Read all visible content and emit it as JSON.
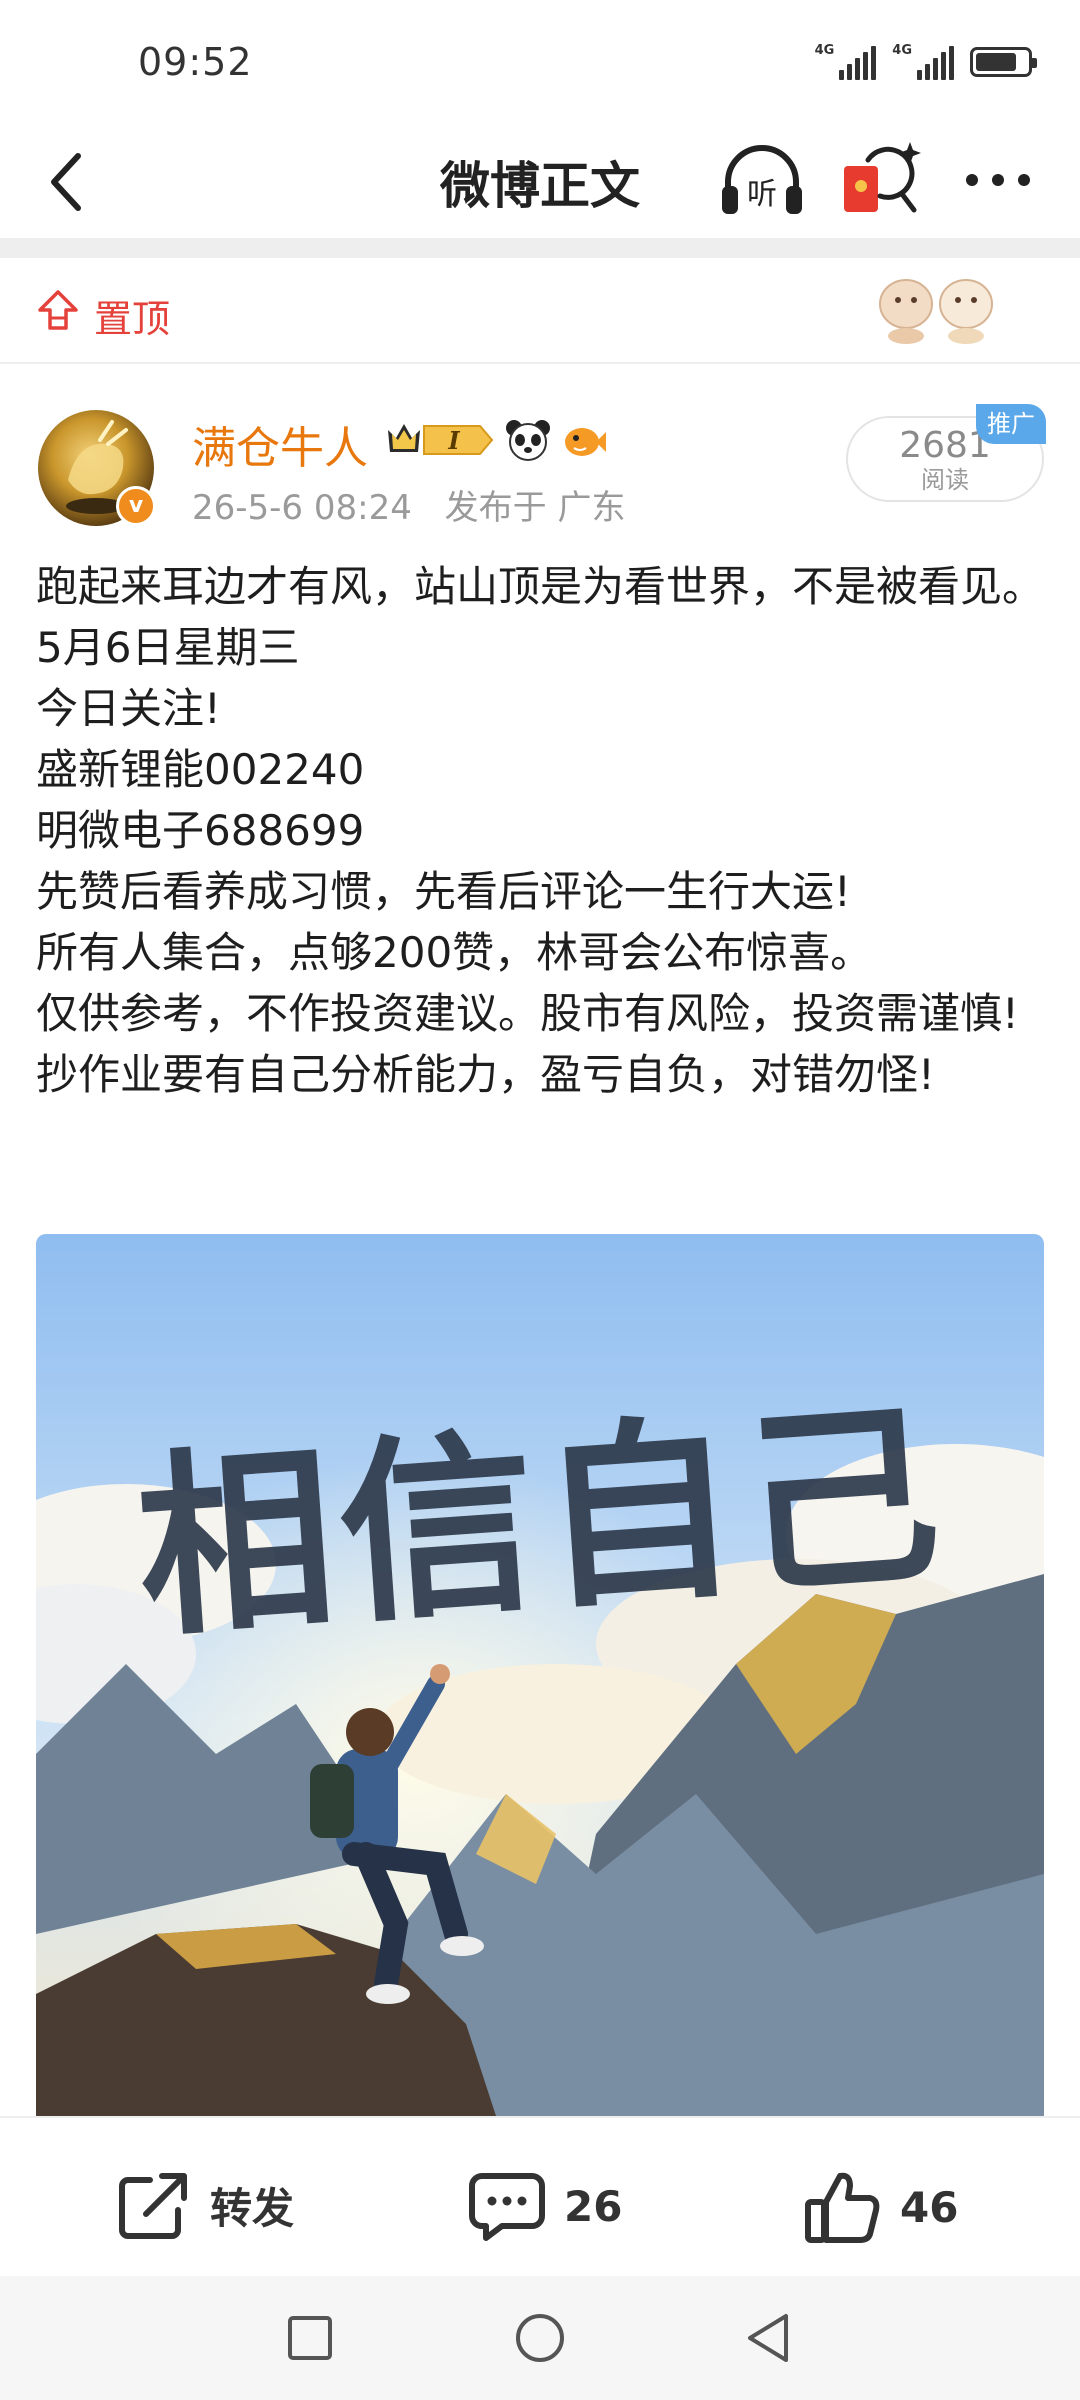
{
  "status_bar": {
    "time": "09:52",
    "network_1": "4G",
    "network_2": "4G"
  },
  "header": {
    "title": "微博正文",
    "listen_label": "听"
  },
  "pinned": {
    "label": "置顶"
  },
  "author": {
    "name": "满仓牛人",
    "level_badge": "I",
    "verified_mark": "v",
    "timestamp": "26-5-6 08:24",
    "location": "发布于 广东"
  },
  "reads": {
    "count": "2681",
    "label": "阅读",
    "promo_label": "推广"
  },
  "post": {
    "lines": [
      "跑起来耳边才有风，站山顶是为看世界，不是被看见。",
      "5月6日星期三",
      "今日关注!",
      "盛新锂能002240",
      "明微电子688699",
      "先赞后看养成习惯，先看后评论一生行大运!",
      "所有人集合，点够200赞，林哥会公布惊喜。",
      "仅供参考，不作投资建议。股市有风险，投资需谨慎!抄作业要有自己分析能力，盈亏自负，对错勿怪!"
    ],
    "image_caption": "相信自己"
  },
  "actions": {
    "repost_label": "转发",
    "comment_count": "26",
    "like_count": "46"
  },
  "colors": {
    "accent_orange": "#e8770e",
    "pin_red": "#e5413b",
    "promo_blue": "#5aa7ea"
  }
}
